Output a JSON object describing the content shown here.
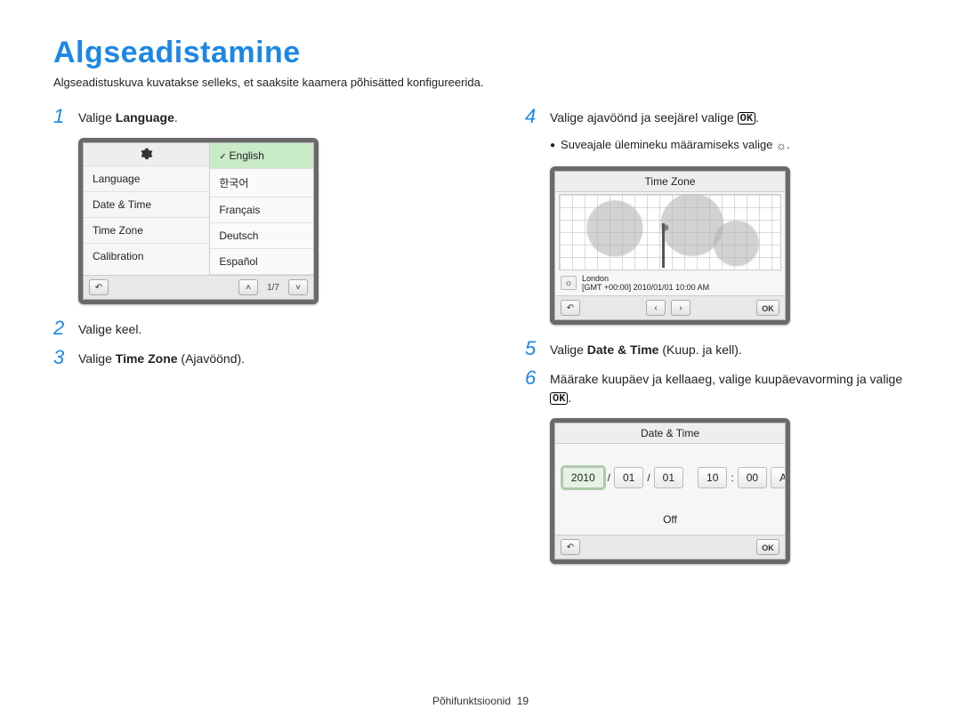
{
  "page": {
    "title": "Algseadistamine",
    "intro": "Algseadistuskuva kuvatakse selleks, et saaksite kaamera põhisätted konfigureerida.",
    "footer_label": "Põhifunktsioonid",
    "footer_page": "19"
  },
  "steps": {
    "s1_prefix": "Valige ",
    "s1_bold": "Language",
    "s1_suffix": ".",
    "s2": "Valige keel.",
    "s3_prefix": "Valige ",
    "s3_bold": "Time Zone",
    "s3_suffix": " (Ajavöönd).",
    "s4_prefix": "Valige ajavöönd ja seejärel valige ",
    "s4_suffix": ".",
    "s4_note_prefix": "Suveajale ülemineku määramiseks valige ",
    "s4_note_suffix": ".",
    "s5_prefix": "Valige ",
    "s5_bold": "Date & Time",
    "s5_suffix": " (Kuup. ja kell).",
    "s6_line": "Määrake kuupäev ja kellaaeg, valige kuupäevavorming ja valige ",
    "s6_suffix": "."
  },
  "icons": {
    "ok": "OK",
    "gear": "✺",
    "back": "↶",
    "down": "˅",
    "up": "˄",
    "left": "‹",
    "right": "›",
    "dst": "☼"
  },
  "lang_screen": {
    "menu": [
      "Language",
      "Date & Time",
      "Time Zone",
      "Calibration"
    ],
    "options": [
      "English",
      "한국어",
      "Français",
      "Deutsch",
      "Español"
    ],
    "pager": "1/7"
  },
  "tz_screen": {
    "title": "Time Zone",
    "city": "London",
    "detail": "[GMT +00:00] 2010/01/01 10:00 AM"
  },
  "dt_screen": {
    "title": "Date & Time",
    "year": "2010",
    "sep1": "/",
    "month": "01",
    "sep2": "/",
    "day": "01",
    "hour": "10",
    "sep3": ":",
    "min": "00",
    "ampm": "AM",
    "format": "Off"
  }
}
